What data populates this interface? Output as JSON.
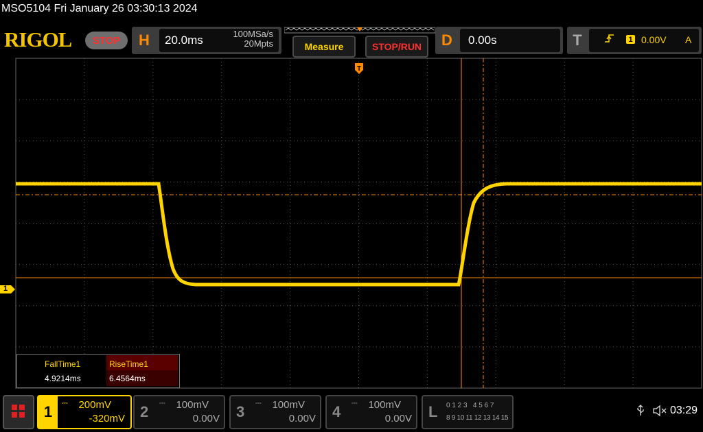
{
  "header": {
    "model_datetime": "MSO5104  Fri January 26 03:30:13 2024",
    "logo": "RIGOL",
    "run_state": "STOP"
  },
  "horizontal": {
    "letter": "H",
    "timebase": "20.0ms",
    "sample_rate": "100MSa/s",
    "memory_depth": "20Mpts"
  },
  "buttons": {
    "measure": "Measure",
    "stop_run": "STOP/RUN"
  },
  "delay": {
    "letter": "D",
    "value": "0.00s"
  },
  "trigger": {
    "letter": "T",
    "edge_icon": "rising-edge-icon",
    "source": "1",
    "level": "0.00V",
    "mode": "A"
  },
  "channel1_marker": "1",
  "measurements": {
    "fall_label": "FallTime1",
    "fall_value": "4.9214ms",
    "rise_label": "RiseTime1",
    "rise_value": "6.4564ms"
  },
  "channels": [
    {
      "num": "1",
      "scale": "200mV",
      "offset": "-320mV",
      "active": true
    },
    {
      "num": "2",
      "scale": "100mV",
      "offset": "0.00V",
      "active": false
    },
    {
      "num": "3",
      "scale": "100mV",
      "offset": "0.00V",
      "active": false
    },
    {
      "num": "4",
      "scale": "100mV",
      "offset": "0.00V",
      "active": false
    }
  ],
  "logic": {
    "letter": "L",
    "row1": "0 1 2 3   4 5 6 7",
    "row2": "8 9 10 11 12 13 14 15"
  },
  "status": {
    "usb_icon": "usb-icon",
    "sound_icon": "mute-icon",
    "time": "03:29"
  },
  "colors": {
    "ch1": "#ffd400",
    "cursor": "#ff8a00",
    "accent_letter": "#ff8a00",
    "stop": "#ff3030"
  }
}
